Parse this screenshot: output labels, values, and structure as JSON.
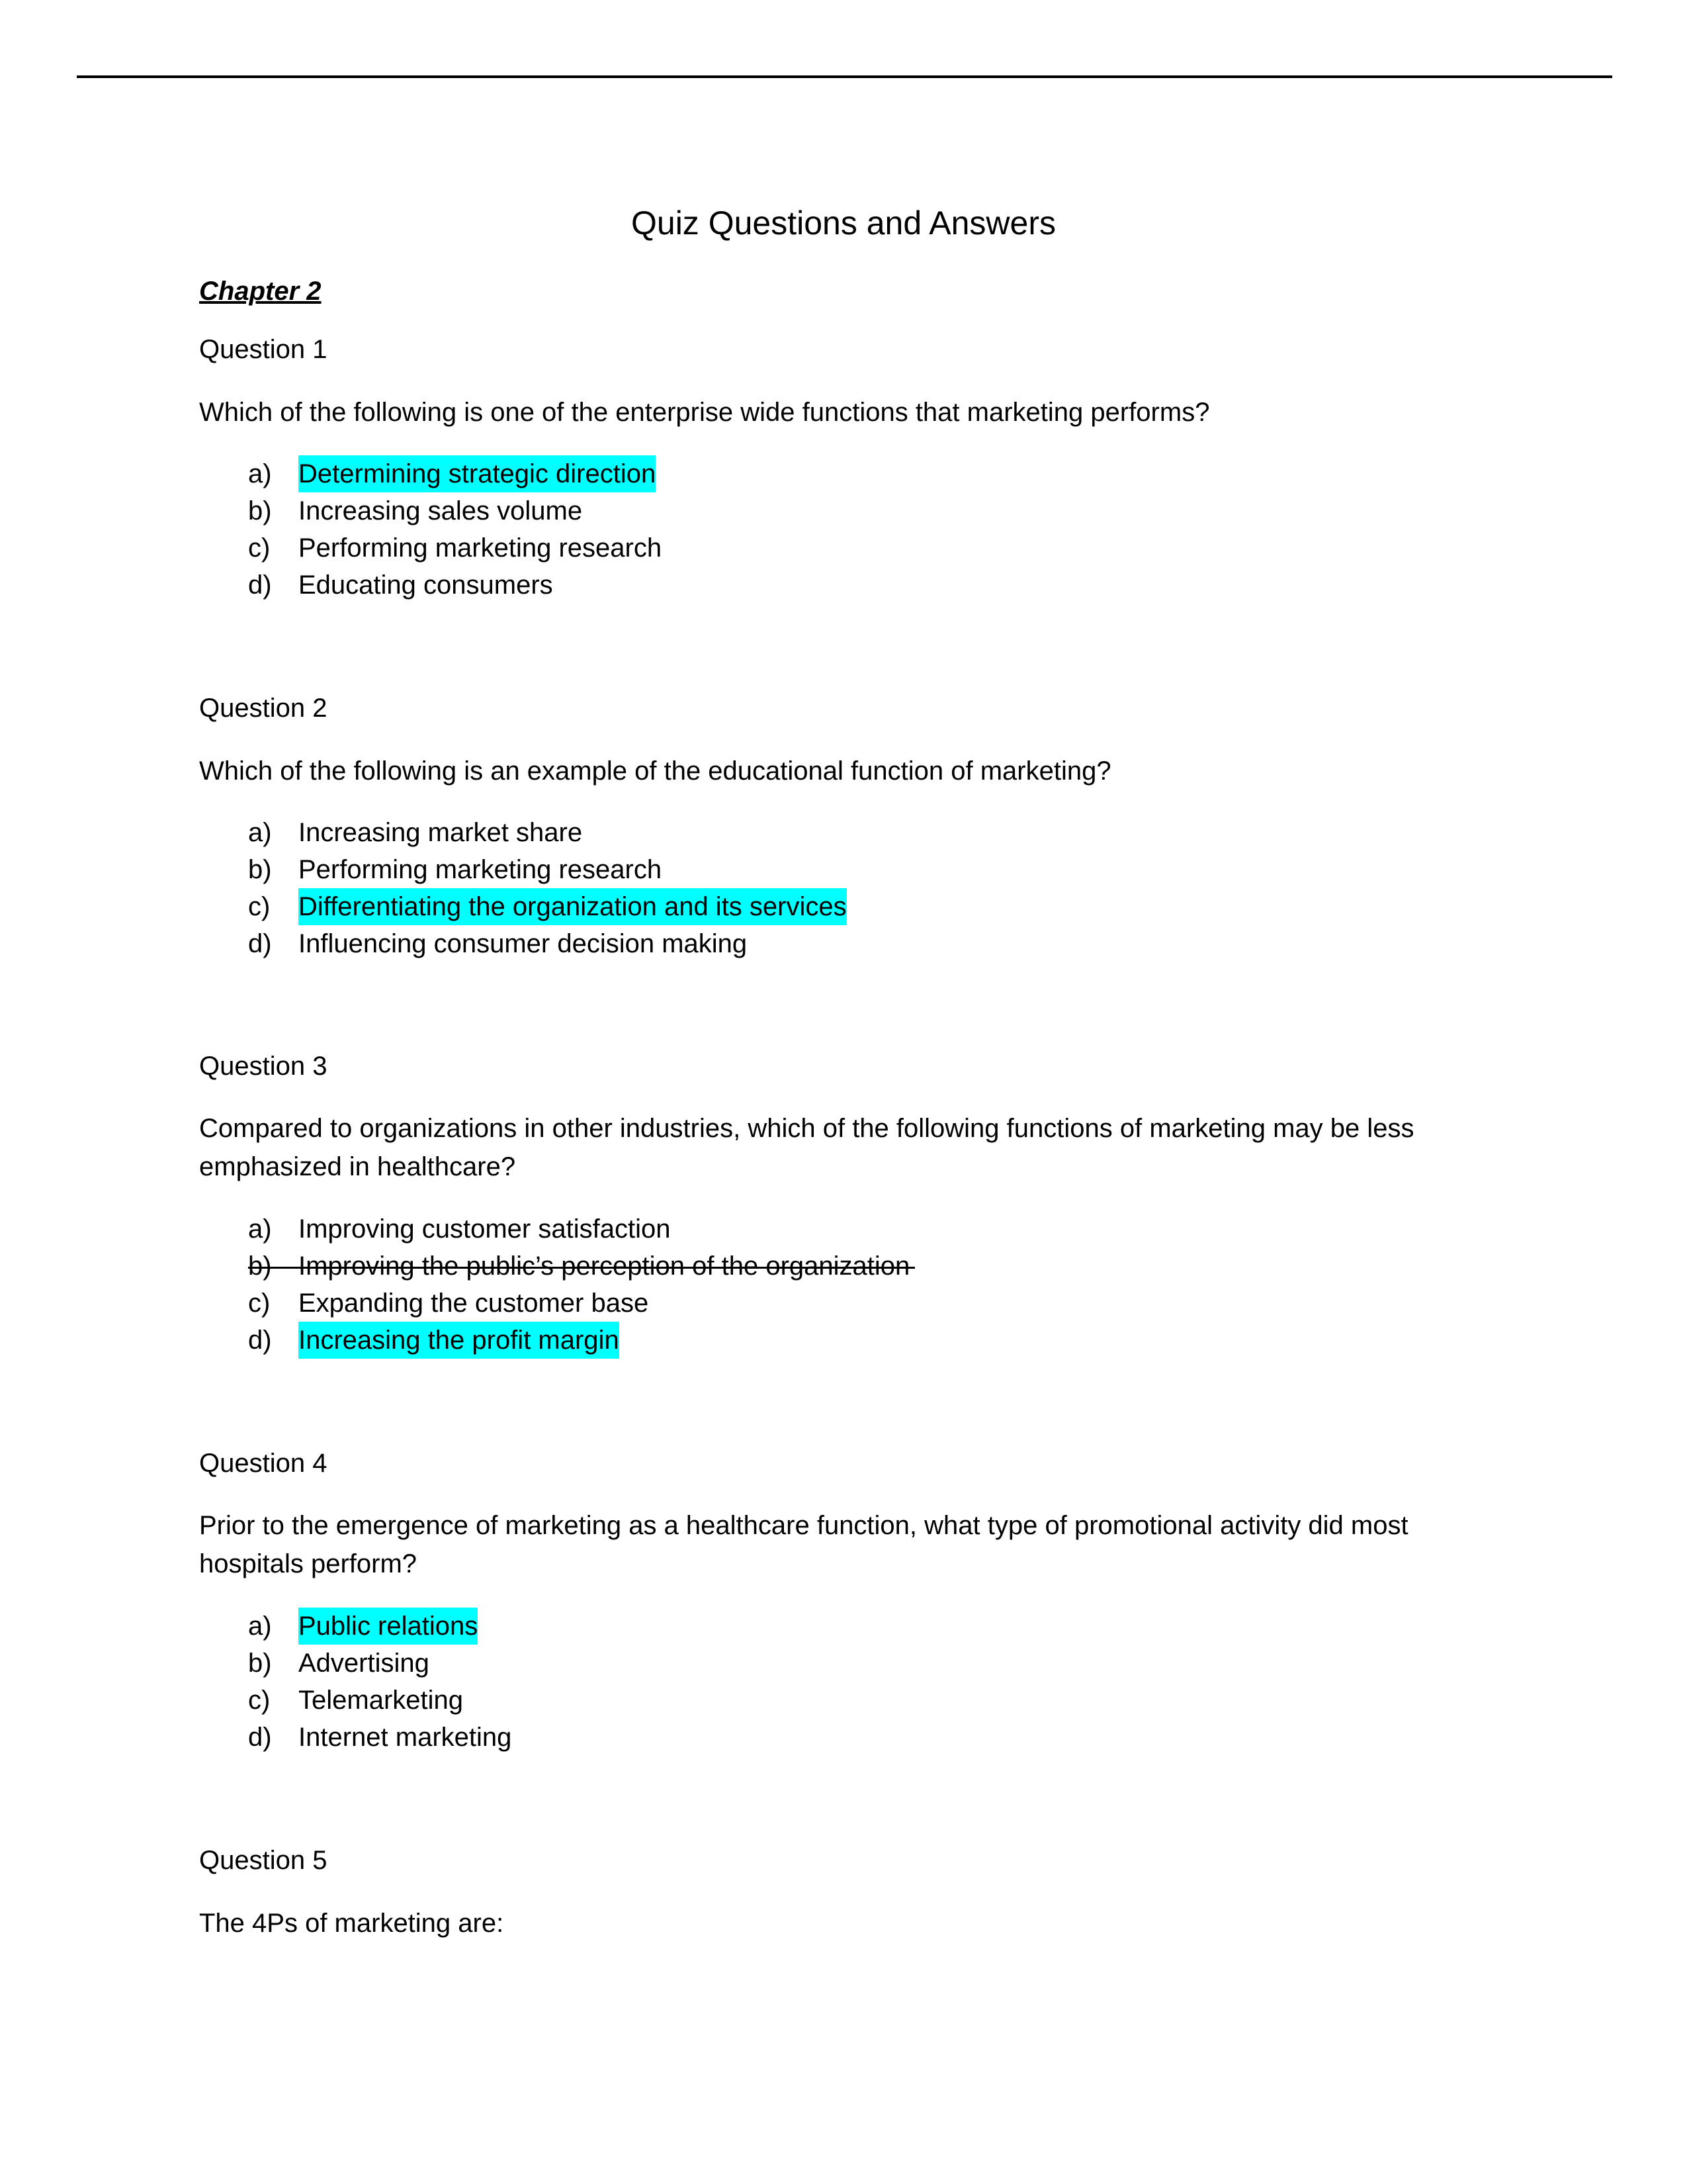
{
  "document": {
    "title": "Quiz Questions and Answers",
    "chapter": "Chapter 2",
    "highlight_color": "#00ffff",
    "spellcheck_underline_color": "#7ccc44"
  },
  "questions": [
    {
      "heading": "Question 1",
      "text": "Which of the following is one of the enterprise wide functions that marketing performs?",
      "options": [
        {
          "letter": "a)",
          "text": "Determining strategic direction",
          "highlighted": true,
          "struck": false
        },
        {
          "letter": "b)",
          "text": "Increasing sales volume",
          "highlighted": false,
          "struck": false
        },
        {
          "letter": "c)",
          "text": "Performing marketing research",
          "highlighted": false,
          "struck": false
        },
        {
          "letter": "d)",
          "text": "Educating consumers",
          "highlighted": false,
          "struck": false
        }
      ]
    },
    {
      "heading": "Question 2",
      "text": "Which of the following is an example of the educational function of marketing?",
      "options": [
        {
          "letter": "a)",
          "text": "Increasing market share",
          "highlighted": false,
          "struck": false
        },
        {
          "letter": "b)",
          "text": "Performing marketing research",
          "highlighted": false,
          "struck": false
        },
        {
          "letter": "c)",
          "text": "Differentiating the organization and its services",
          "highlighted": true,
          "struck": false
        },
        {
          "letter": "d)",
          "text": "Influencing consumer decision making",
          "highlighted": false,
          "struck": false
        }
      ]
    },
    {
      "heading": "Question 3",
      "text": "Compared to organizations in other industries, which of the following functions of marketing may be less emphasized in healthcare?",
      "options": [
        {
          "letter": "a)",
          "text": "Improving customer satisfaction",
          "highlighted": false,
          "struck": false
        },
        {
          "letter": "b)",
          "text": "Improving the public’s perception of the organization",
          "highlighted": false,
          "struck": true
        },
        {
          "letter": "c)",
          "text": "Expanding the customer base",
          "highlighted": false,
          "struck": false
        },
        {
          "letter": "d)",
          "text": "Increasing the profit margin",
          "highlighted": true,
          "struck": false
        }
      ]
    },
    {
      "heading": "Question 4",
      "text": "Prior to the emergence of marketing as a healthcare function, what type of promotional activity did most hospitals perform?",
      "options": [
        {
          "letter": "a)",
          "text": "Public relations",
          "highlighted": true,
          "struck": false
        },
        {
          "letter": "b)",
          "text": "Advertising",
          "highlighted": false,
          "struck": false
        },
        {
          "letter": "c)",
          "text": "Telemarketing",
          "highlighted": false,
          "struck": false
        },
        {
          "letter": "d)",
          "text": "Internet marketing",
          "highlighted": false,
          "struck": false
        }
      ]
    },
    {
      "heading": "Question 5",
      "text": "The 4Ps of marketing are:",
      "options": []
    }
  ]
}
